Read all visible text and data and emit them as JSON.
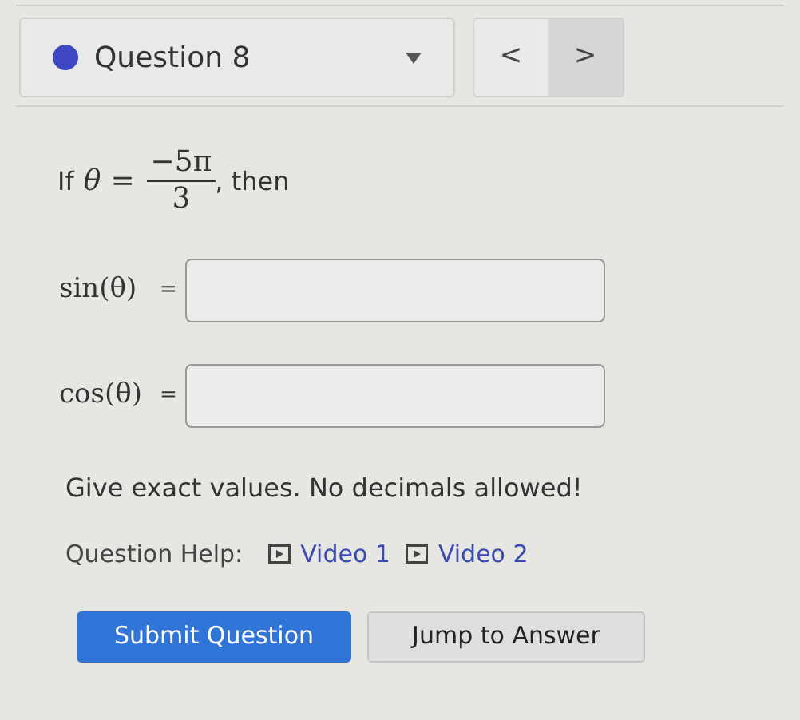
{
  "question_selector": {
    "label": "Question 8"
  },
  "nav": {
    "previous": "<",
    "next": ">"
  },
  "prompt": {
    "lead": "If",
    "variable": "θ",
    "equals": "=",
    "numerator": "−5π",
    "denominator": "3",
    "trail": ", then"
  },
  "fields": [
    {
      "label": "sin(θ)",
      "equals": "="
    },
    {
      "label": "cos(θ)",
      "equals": "="
    }
  ],
  "instruction": "Give exact values. No decimals allowed!",
  "help": {
    "label": "Question Help:",
    "links": [
      "Video 1",
      "Video 2"
    ]
  },
  "buttons": [
    {
      "kind": "primary",
      "label": "Submit Question"
    },
    {
      "kind": "secondary",
      "label": "Jump to Answer"
    }
  ]
}
